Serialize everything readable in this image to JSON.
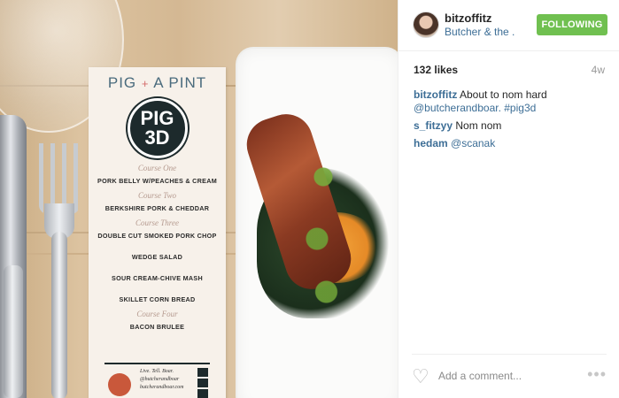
{
  "photo": {
    "menu": {
      "brand_left": "PIG",
      "brand_plus": "+",
      "brand_right": "A PINT",
      "logo_text": "PIG 3D",
      "items": [
        {
          "course": "Course One"
        },
        {
          "dish": "PORK BELLY W/PEACHES & CREAM"
        },
        {
          "course": "Course Two"
        },
        {
          "dish": "BERKSHIRE PORK & CHEDDAR"
        },
        {
          "course": "Course Three"
        },
        {
          "dish": "DOUBLE CUT SMOKED PORK CHOP"
        },
        {
          "dish": "WEDGE SALAD"
        },
        {
          "dish": "SOUR CREAM-CHIVE MASH"
        },
        {
          "dish": "SKILLET CORN BREAD"
        },
        {
          "course": "Course Four"
        },
        {
          "dish": "BACON BRULEE"
        }
      ],
      "footer_tagline": "Live. Tell. Boar.",
      "footer_handle": "@butcherandboar",
      "footer_site": "butcherandboar.com"
    }
  },
  "header": {
    "username": "bitzoffitz",
    "location": "Butcher & the ...",
    "follow_label": "FOLLOWING"
  },
  "meta": {
    "likes": "132 likes",
    "time": "4w"
  },
  "comments": [
    {
      "user": "bitzoffitz",
      "text": "About to nom hard",
      "links": "@butcherandboar. #pig3d"
    },
    {
      "user": "s_fitzyy",
      "text": "Nom nom",
      "links": ""
    },
    {
      "user": "hedam",
      "text": "",
      "links": "@scanak"
    }
  ],
  "footer": {
    "comment_placeholder": "Add a comment...",
    "more_glyph": "•••",
    "heart_glyph": "♡"
  },
  "colors": {
    "link_blue": "#3d6e96",
    "follow_green": "#70c050"
  }
}
